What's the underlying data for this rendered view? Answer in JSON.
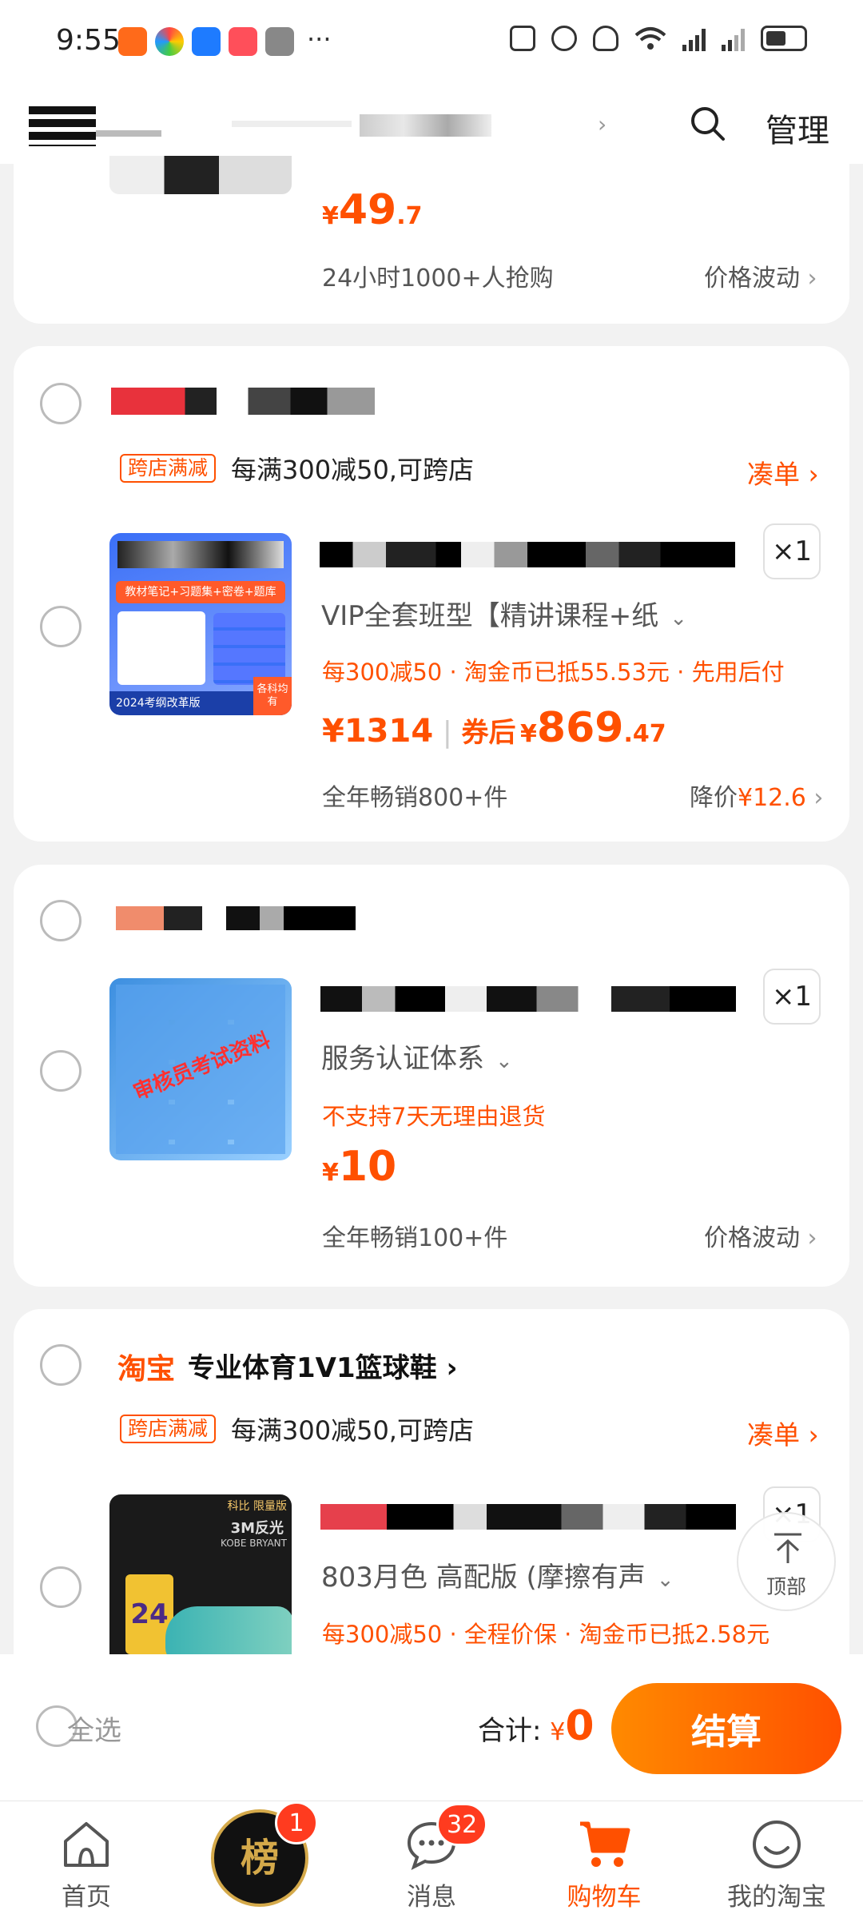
{
  "status_bar": {
    "time": "9:55",
    "more": "···",
    "signal1": "5G",
    "signal2": "5G"
  },
  "top_bar": {
    "manage_label": "管理"
  },
  "item0": {
    "price_cur": "¥",
    "price_int": "49",
    "price_dec": ".7",
    "sales": "24小时1000+人抢购",
    "right_link": "价格波动"
  },
  "shop1": {
    "promo_tag": "跨店满减",
    "promo_text": "每满300减50,可跨店",
    "add_on_label": "凑单",
    "item": {
      "qty": "×1",
      "sku": "VIP全套班型【精讲课程+纸",
      "promo": "每300减50 · 淘金币已抵55.53元 · 先用后付",
      "orig_price": "¥1314",
      "after_coupon_label": "券后",
      "price_cur": "¥",
      "price_int": "869",
      "price_dec": ".47",
      "sales": "全年畅销800+件",
      "right_label": "降价",
      "right_value": "¥12.6",
      "thumb_text": {
        "t1": "教材笔记+习题集+密卷+题库",
        "t2": "2024考纲改革版",
        "t3": "各科均有"
      }
    }
  },
  "shop2": {
    "item": {
      "qty": "×1",
      "sku": "服务认证体系",
      "promo": "不支持7天无理由退货",
      "price_cur": "¥",
      "price_int": "10",
      "sales": "全年畅销100+件",
      "right_link": "价格波动",
      "thumb_text": "审核员考试资料"
    }
  },
  "shop3": {
    "platform": "淘宝",
    "shop_name": "专业体育1V1篮球鞋",
    "promo_tag": "跨店满减",
    "promo_text": "每满300减50,可跨店",
    "add_on_label": "凑单",
    "item": {
      "qty": "×1",
      "sku": "803月色 高配版 (摩擦有声",
      "promo": "每300减50 · 全程价保 · 淘金币已抵2.58元",
      "thumb_text": {
        "t1": "科比 限量版",
        "t2": "3M反光",
        "t3": "KOBE BRYANT",
        "t4": "24"
      }
    }
  },
  "back_to_top": "顶部",
  "checkout": {
    "select_all": "全选",
    "total_label": "合计:",
    "total_cur": "¥",
    "total_amount": "0",
    "button": "结算"
  },
  "tabs": [
    {
      "label": "首页"
    },
    {
      "label": "",
      "badge": "1"
    },
    {
      "label": "消息",
      "badge": "32"
    },
    {
      "label": "购物车"
    },
    {
      "label": "我的淘宝"
    }
  ],
  "colors": {
    "accent": "#ff5000",
    "background": "#f2f2f2"
  }
}
